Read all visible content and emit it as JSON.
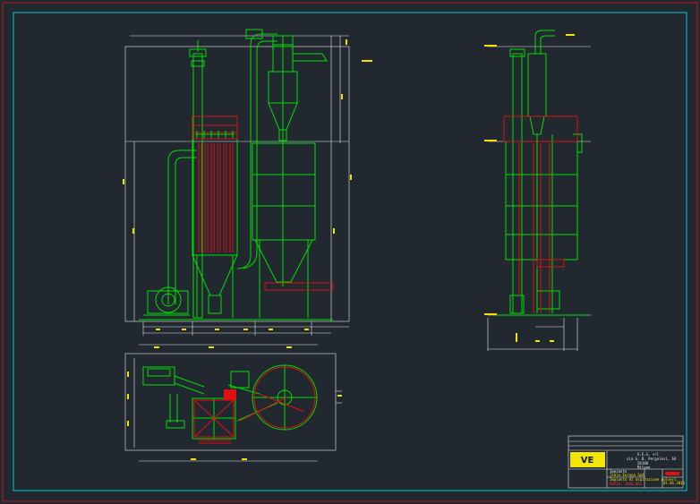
{
  "colors": {
    "background": "#212830",
    "outer_border": "#c01818",
    "inner_border": "#00c8d0",
    "structure": "#00e000",
    "filter_bags": "#e01010",
    "dimension_lines": "#e8e8e8",
    "dimension_text": "#f2e600"
  },
  "title_block": {
    "logo": "VE",
    "company_line_1": "V.E.G. srl",
    "company_line_2": "via G. B. Pergolesi, 64",
    "company_line_3": "20100",
    "company_line_4": "Milano",
    "client_line_1": "Impianto",
    "client_line_2": "Italo Europa SpA",
    "drawing_title": "Impianto di aspirazione polveri",
    "drawing_code": "ASPIR. 2016.001",
    "date": "01.01.2016"
  },
  "views": {
    "front": "front-elevation",
    "side": "side-elevation",
    "plan": "plan-view"
  }
}
